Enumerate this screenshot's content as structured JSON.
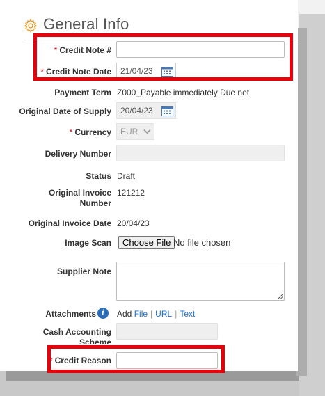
{
  "section": {
    "title": "General Info",
    "icon": "gear-icon"
  },
  "fields": {
    "credit_note_no": {
      "label": "Credit Note #",
      "required": "*",
      "value": ""
    },
    "credit_note_date": {
      "label": "Credit Note Date",
      "required": "*",
      "value": "21/04/23"
    },
    "payment_term": {
      "label": "Payment Term",
      "value": "Z000_Payable immediately Due net"
    },
    "original_supply_date": {
      "label": "Original Date of Supply",
      "value": "20/04/23"
    },
    "currency": {
      "label": "Currency",
      "required": "*",
      "value": "EUR"
    },
    "delivery_number": {
      "label": "Delivery Number",
      "value": ""
    },
    "status": {
      "label": "Status",
      "value": "Draft"
    },
    "original_invoice_number": {
      "label": "Original Invoice Number",
      "value": "121212"
    },
    "original_invoice_date": {
      "label": "Original Invoice Date",
      "value": "20/04/23"
    },
    "image_scan": {
      "label": "Image Scan",
      "button": "Choose File",
      "status": "No file chosen"
    },
    "supplier_note": {
      "label": "Supplier Note",
      "value": ""
    },
    "attachments": {
      "label": "Attachments",
      "info": "i",
      "add": "Add",
      "links": [
        "File",
        "URL",
        "Text"
      ]
    },
    "cash_accounting_scheme": {
      "label": "Cash Accounting Scheme",
      "value": ""
    },
    "credit_reason": {
      "label": "Credit Reason",
      "required": "*",
      "value": ""
    }
  },
  "colors": {
    "required": "#d0021b",
    "link": "#1a73e8",
    "highlight": "#e8000b",
    "info": "#2a6ebb"
  }
}
